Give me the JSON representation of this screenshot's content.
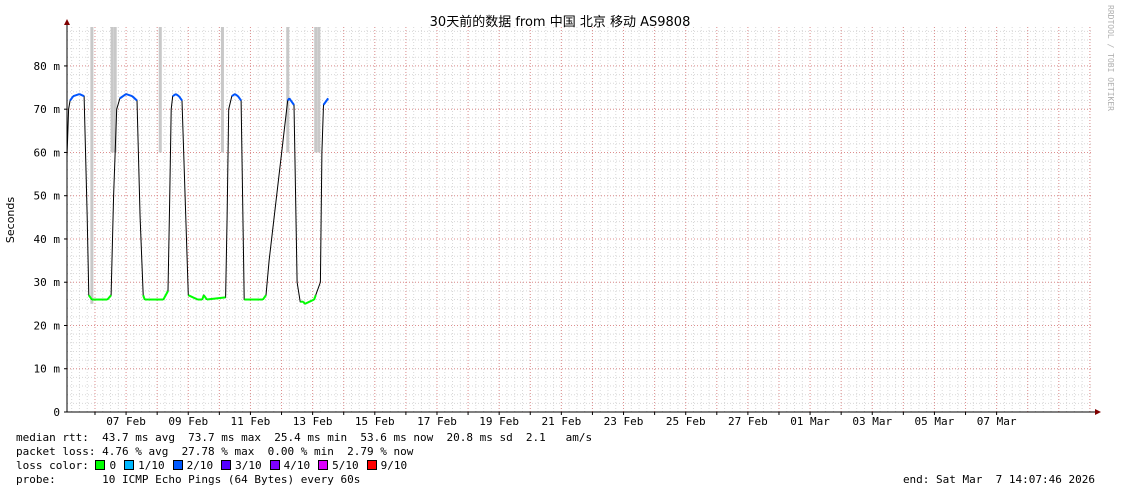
{
  "chart_data": {
    "type": "line",
    "title": "30天前的数据 from 中国 北京 移动 AS9808",
    "ylabel": "Seconds",
    "watermark": "RRDTOOL / TOBI OETIKER",
    "x_ticks": [
      "07 Feb",
      "09 Feb",
      "11 Feb",
      "13 Feb",
      "15 Feb",
      "17 Feb",
      "19 Feb",
      "21 Feb",
      "23 Feb",
      "25 Feb",
      "27 Feb",
      "01 Mar",
      "03 Mar",
      "05 Mar",
      "07 Mar"
    ],
    "x_range_days": [
      -1.9,
      31.1
    ],
    "y_ticks": [
      {
        "value": 0,
        "label": "0"
      },
      {
        "value": 10,
        "label": "10 m"
      },
      {
        "value": 20,
        "label": "20 m"
      },
      {
        "value": 30,
        "label": "30 m"
      },
      {
        "value": 40,
        "label": "40 m"
      },
      {
        "value": 50,
        "label": "50 m"
      },
      {
        "value": 60,
        "label": "60 m"
      },
      {
        "value": 70,
        "label": "70 m"
      },
      {
        "value": 80,
        "label": "80 m"
      }
    ],
    "ylim": [
      0,
      89
    ],
    "grid": true,
    "series": [
      {
        "x": [
          -1.9,
          -1.85,
          -1.8,
          -1.7,
          -1.5,
          -1.35,
          -1.25,
          -1.2,
          -1.1,
          -0.6,
          -0.48,
          -0.4,
          -0.3,
          -0.2,
          -0.1,
          0.0,
          0.2,
          0.35,
          0.45,
          0.55,
          0.6,
          0.7,
          0.8,
          1.2,
          1.35,
          1.4,
          1.45,
          1.5,
          1.6,
          1.7,
          1.8,
          2.0,
          2.3,
          2.45,
          2.5,
          2.6,
          3.2,
          3.25,
          3.3,
          3.4,
          3.5,
          3.6,
          3.7,
          3.8,
          4.0,
          4.3,
          4.4,
          4.5,
          4.6,
          5.2,
          5.25,
          5.3,
          5.4,
          5.5,
          5.6,
          5.7,
          5.75,
          5.9,
          6.05,
          6.1,
          6.25,
          6.3,
          6.35,
          6.5
        ],
        "y": [
          59,
          70,
          72,
          73,
          73.5,
          73,
          45,
          27,
          26,
          26,
          27,
          50,
          70,
          72.5,
          73,
          73.5,
          73,
          72,
          45,
          27,
          26,
          26,
          26,
          26,
          28,
          48,
          70,
          73,
          73.5,
          73,
          72,
          27,
          26,
          26,
          27,
          26,
          26.5,
          45,
          70,
          73,
          73.5,
          73,
          72,
          26,
          26,
          26,
          26,
          27,
          35,
          72,
          72.5,
          72,
          71,
          30,
          25.5,
          25.5,
          25,
          25.5,
          26,
          27,
          30,
          60,
          71,
          72.5
        ]
      }
    ],
    "loss_spikes": [
      {
        "x": -1.1,
        "min": 25,
        "max": 89
      },
      {
        "x": -0.45,
        "min": 60,
        "max": 89
      },
      {
        "x": -0.35,
        "min": 60,
        "max": 89
      },
      {
        "x": 1.1,
        "min": 60,
        "max": 89
      },
      {
        "x": 3.1,
        "min": 60,
        "max": 89
      },
      {
        "x": 5.2,
        "min": 60,
        "max": 89
      },
      {
        "x": 6.1,
        "min": 60,
        "max": 89
      },
      {
        "x": 6.2,
        "min": 60,
        "max": 89
      }
    ],
    "colors": {
      "background": "#ffffff",
      "grid_major": "#e07070",
      "grid_minor": "#d8d8d8",
      "axis": "#000000",
      "arrow": "#800000",
      "line": "#000000",
      "smoke": "#c8c8c8",
      "low_loss": "#00ff00",
      "high_seg": "#0055ff"
    }
  },
  "stats": {
    "median_rtt": "median rtt:  43.7 ms avg  73.7 ms max  25.4 ms min  53.6 ms now  20.8 ms sd  2.1   am/s",
    "packet_loss": "packet loss: 4.76 % avg  27.78 % max  0.00 % min  2.79 % now",
    "loss_color_label": "loss color: ",
    "loss_colors": [
      {
        "label": "0",
        "color": "#00ff00"
      },
      {
        "label": "1/10",
        "color": "#00b8ff"
      },
      {
        "label": "2/10",
        "color": "#0059ff"
      },
      {
        "label": "3/10",
        "color": "#5500ff"
      },
      {
        "label": "4/10",
        "color": "#7e00ff"
      },
      {
        "label": "5/10",
        "color": "#dd00ff"
      },
      {
        "label": "9/10",
        "color": "#ff0000"
      }
    ],
    "probe": "probe:       10 ICMP Echo Pings (64 Bytes) every 60s",
    "end": "end: Sat Mar  7 14:07:46 2026"
  }
}
